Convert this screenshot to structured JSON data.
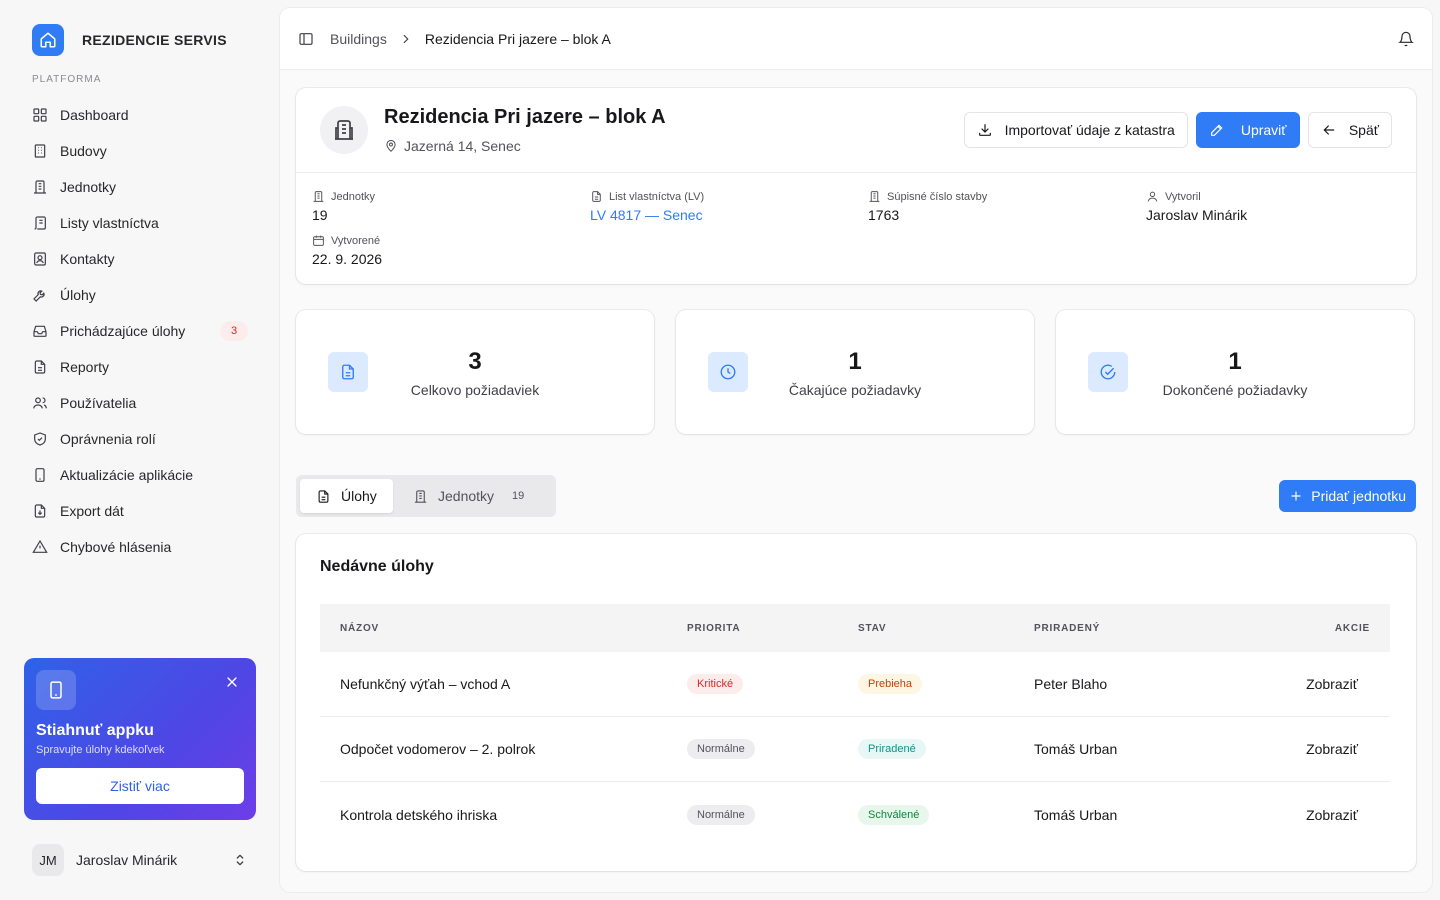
{
  "brand": {
    "name": "REZIDENCIE SERVIS"
  },
  "sidebar": {
    "section": "PLATFORMA",
    "items": [
      {
        "label": "Dashboard",
        "icon": "dashboard-icon"
      },
      {
        "label": "Budovy",
        "icon": "building-icon"
      },
      {
        "label": "Jednotky",
        "icon": "units-icon"
      },
      {
        "label": "Listy vlastníctva",
        "icon": "scroll-icon"
      },
      {
        "label": "Kontakty",
        "icon": "contact-icon"
      },
      {
        "label": "Úlohy",
        "icon": "wrench-icon"
      },
      {
        "label": "Prichádzajúce úlohy",
        "icon": "inbox-icon",
        "badge": "3"
      },
      {
        "label": "Reporty",
        "icon": "report-icon"
      },
      {
        "label": "Používatelia",
        "icon": "users-icon"
      },
      {
        "label": "Oprávnenia rolí",
        "icon": "shield-icon"
      },
      {
        "label": "Aktualizácie aplikácie",
        "icon": "phone-icon"
      },
      {
        "label": "Export dát",
        "icon": "export-icon"
      },
      {
        "label": "Chybové hlásenia",
        "icon": "warning-icon"
      }
    ]
  },
  "promo": {
    "title": "Stiahnuť appku",
    "subtitle": "Spravujte úlohy kdekoľvek",
    "button": "Zistiť viac"
  },
  "user": {
    "initials": "JM",
    "name": "Jaroslav Minárik"
  },
  "breadcrumb": {
    "parent": "Buildings",
    "current": "Rezidencia Pri jazere – blok A"
  },
  "building": {
    "title": "Rezidencia Pri jazere – blok A",
    "address": "Jazerná 14, Senec",
    "actions": {
      "import": "Importovať údaje z katastra",
      "edit": "Upraviť",
      "back": "Späť"
    },
    "meta": {
      "units_label": "Jednotky",
      "units_value": "19",
      "lv_label": "List vlastníctva (LV)",
      "lv_value": "LV 4817 — Senec",
      "supisne_label": "Súpisné číslo stavby",
      "supisne_value": "1763",
      "creator_label": "Vytvoril",
      "creator_value": "Jaroslav Minárik",
      "created_label": "Vytvorené",
      "created_value": "22. 9. 2026"
    }
  },
  "stats": [
    {
      "value": "3",
      "label": "Celkovo požiadaviek",
      "icon": "document-icon"
    },
    {
      "value": "1",
      "label": "Čakajúce požiadavky",
      "icon": "clock-icon"
    },
    {
      "value": "1",
      "label": "Dokončené požiadavky",
      "icon": "check-circle-icon"
    }
  ],
  "tabs": [
    {
      "label": "Úlohy"
    },
    {
      "label": "Jednotky",
      "count": "19"
    }
  ],
  "add_unit": "Pridať jednotku",
  "tasks": {
    "title": "Nedávne úlohy",
    "columns": [
      "NÁZOV",
      "PRIORITA",
      "STAV",
      "PRIRADENÝ",
      "AKCIE"
    ],
    "rows": [
      {
        "name": "Nefunkčný výťah – vchod A",
        "priority": "Kritické",
        "status": "Prebieha",
        "assignee": "Peter Blaho",
        "action": "Zobraziť"
      },
      {
        "name": "Odpočet vodomerov – 2. polrok",
        "priority": "Normálne",
        "status": "Priradené",
        "assignee": "Tomáš Urban",
        "action": "Zobraziť"
      },
      {
        "name": "Kontrola detského ihriska",
        "priority": "Normálne",
        "status": "Schválené",
        "assignee": "Tomáš Urban",
        "action": "Zobraziť"
      }
    ]
  },
  "colors": {
    "accent": "#2f7cf6",
    "priority_critical_bg": "#fdecec",
    "priority_critical_fg": "#dc2626",
    "priority_normal_bg": "#ededf0",
    "priority_normal_fg": "#52525b",
    "status_progress_bg": "#fdf6e3",
    "status_progress_fg": "#c2410c",
    "status_assigned_bg": "#e6f7f5",
    "status_assigned_fg": "#0d9488",
    "status_approved_bg": "#e8f7ec",
    "status_approved_fg": "#15803d"
  }
}
